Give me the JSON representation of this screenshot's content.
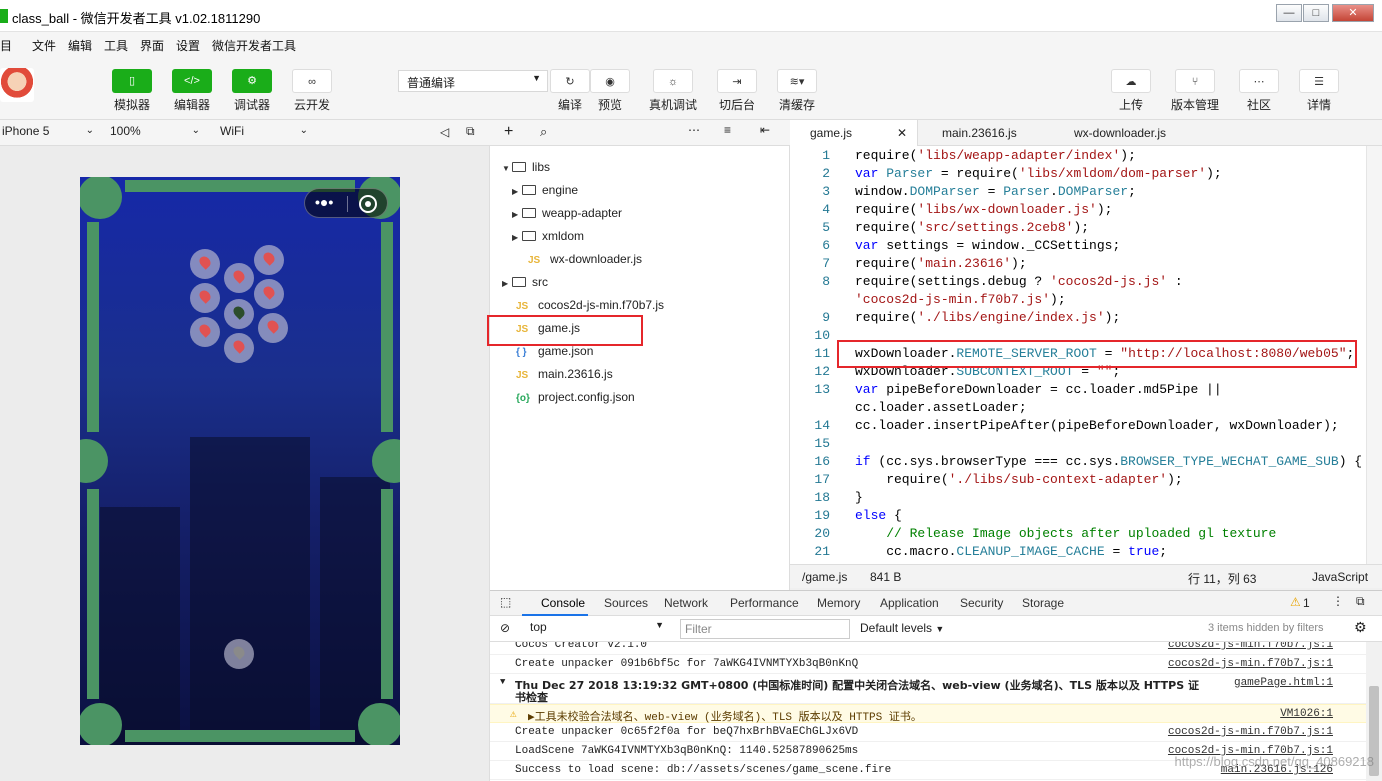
{
  "window": {
    "title": "class_ball - 微信开发者工具 v1.02.1811290",
    "controls": {
      "minimize": "—",
      "maximize": "□",
      "close": "✕"
    }
  },
  "menu": [
    "项目",
    "文件",
    "编辑",
    "工具",
    "界面",
    "设置",
    "微信开发者工具"
  ],
  "toolbar": {
    "left_buttons": [
      {
        "label": "模拟器",
        "icon": "phone-icon"
      },
      {
        "label": "编辑器",
        "icon": "code-icon"
      },
      {
        "label": "调试器",
        "icon": "debug-icon"
      },
      {
        "label": "云开发",
        "icon": "cloud-link-icon"
      }
    ],
    "compile_mode": "普通编译",
    "mid_buttons": [
      {
        "label": "编译",
        "icon": "refresh-icon"
      },
      {
        "label": "预览",
        "icon": "eye-icon"
      },
      {
        "label": "真机调试",
        "icon": "bug-icon"
      },
      {
        "label": "切后台",
        "icon": "switch-icon"
      },
      {
        "label": "清缓存",
        "icon": "layers-icon"
      }
    ],
    "right_buttons": [
      {
        "label": "上传",
        "icon": "upload-icon"
      },
      {
        "label": "版本管理",
        "icon": "branch-icon"
      },
      {
        "label": "社区",
        "icon": "chat-icon"
      },
      {
        "label": "详情",
        "icon": "menu-icon"
      }
    ]
  },
  "device_bar": {
    "device": "iPhone 5",
    "zoom": "100%",
    "network": "WiFi"
  },
  "file_tree": [
    {
      "name": "libs",
      "type": "folder",
      "open": true,
      "depth": 0
    },
    {
      "name": "engine",
      "type": "folder",
      "open": false,
      "depth": 1
    },
    {
      "name": "weapp-adapter",
      "type": "folder",
      "open": false,
      "depth": 1
    },
    {
      "name": "xmldom",
      "type": "folder",
      "open": false,
      "depth": 1
    },
    {
      "name": "wx-downloader.js",
      "type": "js",
      "depth": 1
    },
    {
      "name": "src",
      "type": "folder",
      "open": false,
      "depth": 0
    },
    {
      "name": "cocos2d-js-min.f70b7.js",
      "type": "js",
      "depth": 0
    },
    {
      "name": "game.js",
      "type": "js",
      "depth": 0,
      "highlighted": true
    },
    {
      "name": "game.json",
      "type": "json",
      "depth": 0
    },
    {
      "name": "main.23616.js",
      "type": "js",
      "depth": 0
    },
    {
      "name": "project.config.json",
      "type": "config",
      "depth": 0
    }
  ],
  "editor_tabs": [
    {
      "label": "game.js",
      "active": true,
      "close": "✕"
    },
    {
      "label": "main.23616.js",
      "active": false
    },
    {
      "label": "wx-downloader.js",
      "active": false
    }
  ],
  "code_lines": [
    {
      "n": "1",
      "html": "require(<span class='str'>'libs/weapp-adapter/index'</span>);"
    },
    {
      "n": "2",
      "html": "<span class='kw'>var</span> <span class='prop'>Parser</span> = require(<span class='str'>'libs/xmldom/dom-parser'</span>);"
    },
    {
      "n": "3",
      "html": "window.<span class='prop'>DOMParser</span> = <span class='prop'>Parser</span>.<span class='prop'>DOMParser</span>;"
    },
    {
      "n": "4",
      "html": "require(<span class='str'>'libs/wx-downloader.js'</span>);"
    },
    {
      "n": "5",
      "html": "require(<span class='str'>'src/settings.2ceb8'</span>);"
    },
    {
      "n": "6",
      "html": "<span class='kw'>var</span> settings = window._CCSettings;"
    },
    {
      "n": "7",
      "html": "require(<span class='str'>'main.23616'</span>);"
    },
    {
      "n": "8",
      "html": "require(settings.debug ? <span class='str'>'cocos2d-js.js'</span> :"
    },
    {
      "n": "",
      "html": "<span class='str'>'cocos2d-js-min.f70b7.js'</span>);"
    },
    {
      "n": "9",
      "html": "require(<span class='str'>'./libs/engine/index.js'</span>);"
    },
    {
      "n": "10",
      "html": ""
    },
    {
      "n": "11",
      "html": "wxDownloader.<span class='prop'>REMOTE_SERVER_ROOT</span> = <span class='str'>\"http://localhost:8080/web05\"</span>;"
    },
    {
      "n": "12",
      "html": "wxDownloader.<span class='prop'>SUBCONTEXT_ROOT</span> = <span class='str'>\"\"</span>;"
    },
    {
      "n": "13",
      "html": "<span class='kw'>var</span> pipeBeforeDownloader = cc.loader.md5Pipe ||"
    },
    {
      "n": "",
      "html": "cc.loader.assetLoader;"
    },
    {
      "n": "14",
      "html": "cc.loader.insertPipeAfter(pipeBeforeDownloader, wxDownloader);"
    },
    {
      "n": "15",
      "html": ""
    },
    {
      "n": "16",
      "html": "<span class='kw'>if</span> (cc.sys.browserType === cc.sys.<span class='prop'>BROWSER_TYPE_WECHAT_GAME_SUB</span>) {"
    },
    {
      "n": "17",
      "html": "    require(<span class='str'>'./libs/sub-context-adapter'</span>);"
    },
    {
      "n": "18",
      "html": "}"
    },
    {
      "n": "19",
      "html": "<span class='kw'>else</span> {"
    },
    {
      "n": "20",
      "html": "    <span class='cmt'>// Release Image objects after uploaded gl texture</span>"
    },
    {
      "n": "21",
      "html": "    cc.macro.<span class='prop'>CLEANUP_IMAGE_CACHE</span> = <span class='kw'>true</span>;"
    }
  ],
  "status_bar": {
    "path": "/game.js",
    "size": "841 B",
    "cursor": "行 11，列 63",
    "lang": "JavaScript"
  },
  "devtools_tabs": [
    "Console",
    "Sources",
    "Network",
    "Performance",
    "Memory",
    "Application",
    "Security",
    "Storage"
  ],
  "devtools_warn_count": "1",
  "console_filter": {
    "context": "top",
    "filter_placeholder": "Filter",
    "levels": "Default levels",
    "hidden": "3 items hidden by filters"
  },
  "console_rows": [
    {
      "msg": "Cocos Creator v2.1.0",
      "src": "cocos2d-js-min.f70b7.js:1"
    },
    {
      "msg": "Create unpacker 091b6bf5c for 7aWKG4IVNMTYXb3qB0nKnQ",
      "src": "cocos2d-js-min.f70b7.js:1"
    },
    {
      "msg": "Thu Dec 27 2018 13:19:32 GMT+0800 (中国标准时间) 配置中关闭合法域名、web-view (业务域名)、TLS 版本以及 HTTPS 证",
      "msg2": "书检查",
      "src": "gamePage.html:1"
    },
    {
      "msg": "▶工具未校验合法域名、web-view (业务域名)、TLS 版本以及 HTTPS 证书。",
      "src": "VM1026:1",
      "warn": true
    },
    {
      "msg": "Create unpacker 0c65f2f0a for beQ7hxBrhBVaEChGLJx6VD",
      "src": "cocos2d-js-min.f70b7.js:1"
    },
    {
      "msg": "LoadScene 7aWKG4IVNMTYXb3qB0nKnQ: 1140.52587890625ms",
      "src": "cocos2d-js-min.f70b7.js:1"
    },
    {
      "msg": "Success to load scene: db://assets/scenes/game_scene.fire",
      "src": "main.23616.js:126"
    }
  ],
  "watermark": "https://blog.csdn.net/qq_40869218"
}
